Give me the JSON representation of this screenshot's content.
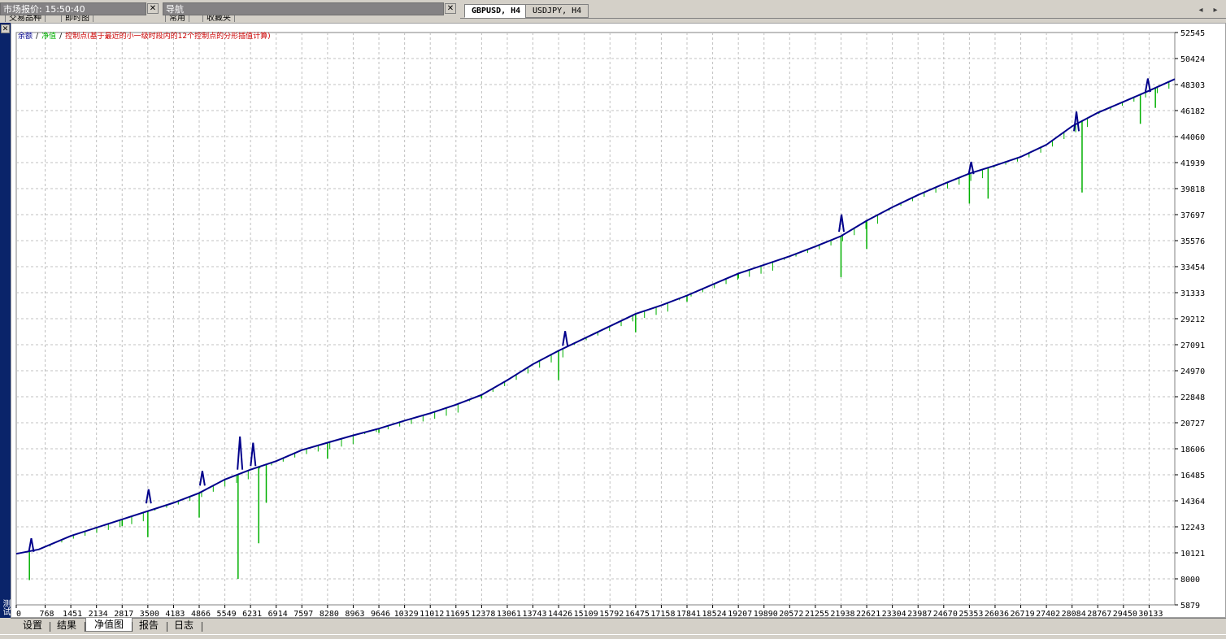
{
  "top": {
    "market_watch_title": "市场报价: 15:50:40",
    "navigator_title": "导航",
    "market_subtabs": [
      "交易品种",
      "即时图"
    ],
    "navigator_subtabs": [
      "常用",
      "收藏夹"
    ],
    "chart_tabs": [
      {
        "label": "GBPUSD, H4",
        "active": true
      },
      {
        "label": "USDJPY, H4",
        "active": false
      }
    ]
  },
  "sidebar": {
    "label": "测试"
  },
  "chart": {
    "legend": {
      "balance": "余额",
      "equity": "净值",
      "separator": "/",
      "description": "控制点(基于最近的小一级时段内的12个控制点的分形插值计算)"
    },
    "y_labels": [
      "52545",
      "50424",
      "48303",
      "46182",
      "44060",
      "41939",
      "39818",
      "37697",
      "35576",
      "33454",
      "31333",
      "29212",
      "27091",
      "24970",
      "22848",
      "20727",
      "18606",
      "16485",
      "14364",
      "12243",
      "10121",
      "8000",
      "5879"
    ],
    "x_labels": [
      "0",
      "768",
      "1451",
      "2134",
      "2817",
      "3500",
      "4183",
      "4866",
      "5549",
      "6231",
      "6914",
      "7597",
      "8280",
      "8963",
      "9646",
      "10329",
      "11012",
      "11695",
      "12378",
      "13061",
      "13743",
      "14426",
      "15109",
      "15792",
      "16475",
      "17158",
      "17841",
      "18524",
      "19207",
      "19890",
      "20572",
      "21255",
      "21938",
      "22621",
      "23304",
      "23987",
      "24670",
      "25353",
      "26036",
      "26719",
      "27402",
      "28084",
      "28767",
      "29450",
      "30133"
    ],
    "colors": {
      "balance": "#00008b",
      "equity": "#00b000",
      "description": "#cc0000",
      "grid": "#c0c0c0",
      "background": "#ffffff"
    }
  },
  "chart_data": {
    "type": "line",
    "ylim": [
      5879,
      52545
    ],
    "xlim": [
      0,
      30816
    ],
    "series": [
      {
        "name": "余额",
        "points": [
          [
            0,
            10040
          ],
          [
            600,
            10400
          ],
          [
            1451,
            11500
          ],
          [
            2817,
            12850
          ],
          [
            4183,
            14200
          ],
          [
            4866,
            15000
          ],
          [
            5549,
            16100
          ],
          [
            6231,
            16900
          ],
          [
            6914,
            17600
          ],
          [
            7597,
            18500
          ],
          [
            8280,
            19100
          ],
          [
            8963,
            19700
          ],
          [
            9646,
            20250
          ],
          [
            10329,
            20900
          ],
          [
            11012,
            21500
          ],
          [
            11695,
            22200
          ],
          [
            12378,
            23000
          ],
          [
            13061,
            24200
          ],
          [
            13743,
            25500
          ],
          [
            14426,
            26600
          ],
          [
            15109,
            27600
          ],
          [
            15792,
            28600
          ],
          [
            16475,
            29600
          ],
          [
            17158,
            30300
          ],
          [
            17841,
            31100
          ],
          [
            18524,
            32000
          ],
          [
            19207,
            32900
          ],
          [
            19890,
            33600
          ],
          [
            20572,
            34300
          ],
          [
            21255,
            35100
          ],
          [
            21938,
            35950
          ],
          [
            22621,
            37200
          ],
          [
            23304,
            38300
          ],
          [
            23987,
            39300
          ],
          [
            24670,
            40200
          ],
          [
            25353,
            41050
          ],
          [
            26036,
            41700
          ],
          [
            26719,
            42400
          ],
          [
            27402,
            43400
          ],
          [
            28084,
            44900
          ],
          [
            28767,
            46000
          ],
          [
            29450,
            46900
          ],
          [
            30133,
            47800
          ],
          [
            30816,
            48750
          ]
        ]
      },
      {
        "name": "净值",
        "points": [
          [
            350,
            7900
          ],
          [
            2817,
            12300
          ],
          [
            3500,
            11400
          ],
          [
            4866,
            13000
          ],
          [
            5900,
            8000
          ],
          [
            6450,
            10900
          ],
          [
            6650,
            14200
          ],
          [
            8280,
            17800
          ],
          [
            9646,
            19900
          ],
          [
            12378,
            22700
          ],
          [
            14426,
            24200
          ],
          [
            16475,
            28100
          ],
          [
            17841,
            30600
          ],
          [
            19207,
            32500
          ],
          [
            21938,
            32600
          ],
          [
            22621,
            34900
          ],
          [
            25353,
            38600
          ],
          [
            25850,
            39000
          ],
          [
            28350,
            39500
          ],
          [
            29900,
            45100
          ],
          [
            30300,
            46400
          ]
        ]
      }
    ],
    "spikes": [
      {
        "x": 400,
        "base": 10200,
        "top": 11300
      },
      {
        "x": 3520,
        "base": 14150,
        "top": 15300
      },
      {
        "x": 4950,
        "base": 15600,
        "top": 16800
      },
      {
        "x": 5950,
        "base": 16900,
        "top": 19600
      },
      {
        "x": 6300,
        "base": 17200,
        "top": 19100
      },
      {
        "x": 14600,
        "base": 27000,
        "top": 28200
      },
      {
        "x": 21950,
        "base": 36300,
        "top": 37700
      },
      {
        "x": 25400,
        "base": 41000,
        "top": 42000
      },
      {
        "x": 28200,
        "base": 44500,
        "top": 46100
      },
      {
        "x": 30100,
        "base": 47700,
        "top": 48800
      }
    ]
  }
}
